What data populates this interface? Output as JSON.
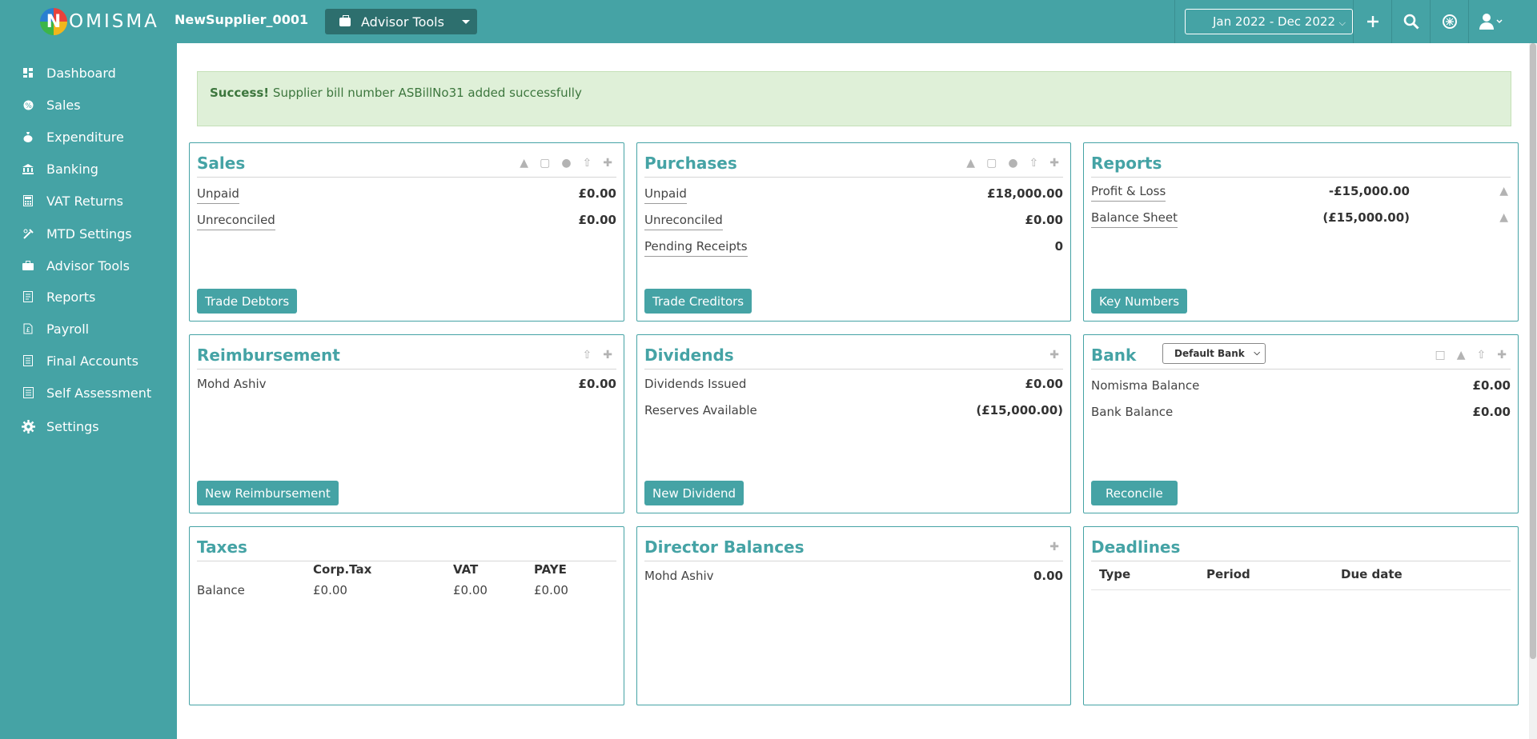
{
  "app": {
    "logo_initial": "N",
    "logo_text": "OMISMA",
    "company_name": "NewSupplier_0001",
    "advisor_button_label": "Advisor Tools",
    "period_selector": "Jan 2022 - Dec 2022"
  },
  "sidebar": {
    "items": [
      {
        "label": "Dashboard",
        "icon": "dashboard-icon"
      },
      {
        "label": "Sales",
        "icon": "sales-icon"
      },
      {
        "label": "Expenditure",
        "icon": "money-bag-icon"
      },
      {
        "label": "Banking",
        "icon": "bank-icon"
      },
      {
        "label": "VAT Returns",
        "icon": "calculator-icon"
      },
      {
        "label": "MTD Settings",
        "icon": "tools-icon"
      },
      {
        "label": "Advisor Tools",
        "icon": "briefcase-icon"
      },
      {
        "label": "Reports",
        "icon": "report-icon"
      },
      {
        "label": "Payroll",
        "icon": "payroll-icon"
      },
      {
        "label": "Final Accounts",
        "icon": "accounts-icon"
      },
      {
        "label": "Self Assessment",
        "icon": "assessment-icon"
      },
      {
        "label": "Settings",
        "icon": "gear-icon"
      }
    ]
  },
  "alert": {
    "strong": "Success!",
    "message": "Supplier bill number ASBillNo31 added successfully"
  },
  "sales": {
    "title": "Sales",
    "rows": [
      {
        "label": "Unpaid",
        "value": "£0.00"
      },
      {
        "label": "Unreconciled",
        "value": "£0.00"
      }
    ],
    "button": "Trade Debtors"
  },
  "purchases": {
    "title": "Purchases",
    "rows": [
      {
        "label": "Unpaid",
        "value": "£18,000.00"
      },
      {
        "label": "Unreconciled",
        "value": "£0.00"
      },
      {
        "label": "Pending Receipts",
        "value": "0"
      }
    ],
    "button": "Trade Creditors"
  },
  "reports": {
    "title": "Reports",
    "rows": [
      {
        "label": "Profit & Loss",
        "value": "-£15,000.00"
      },
      {
        "label": "Balance Sheet",
        "value": "(£15,000.00)"
      }
    ],
    "button": "Key Numbers"
  },
  "reimbursement": {
    "title": "Reimbursement",
    "rows": [
      {
        "label": "Mohd Ashiv",
        "value": "£0.00"
      }
    ],
    "button": "New Reimbursement"
  },
  "dividends": {
    "title": "Dividends",
    "rows": [
      {
        "label": "Dividends Issued",
        "value": "£0.00"
      },
      {
        "label": "Reserves Available",
        "value": "(£15,000.00)"
      }
    ],
    "button": "New Dividend"
  },
  "bank": {
    "title": "Bank",
    "select_value": "Default Bank",
    "rows": [
      {
        "label": "Nomisma Balance",
        "value": "£0.00"
      },
      {
        "label": "Bank Balance",
        "value": "£0.00"
      }
    ],
    "button": "Reconcile"
  },
  "taxes": {
    "title": "Taxes",
    "headers": [
      "Corp.Tax",
      "VAT",
      "PAYE"
    ],
    "row_label": "Balance",
    "values": [
      "£0.00",
      "£0.00",
      "£0.00"
    ]
  },
  "director_balances": {
    "title": "Director Balances",
    "rows": [
      {
        "label": "Mohd Ashiv",
        "value": "0.00"
      }
    ]
  },
  "deadlines": {
    "title": "Deadlines",
    "headers": [
      "Type",
      "Period",
      "Due date"
    ]
  }
}
